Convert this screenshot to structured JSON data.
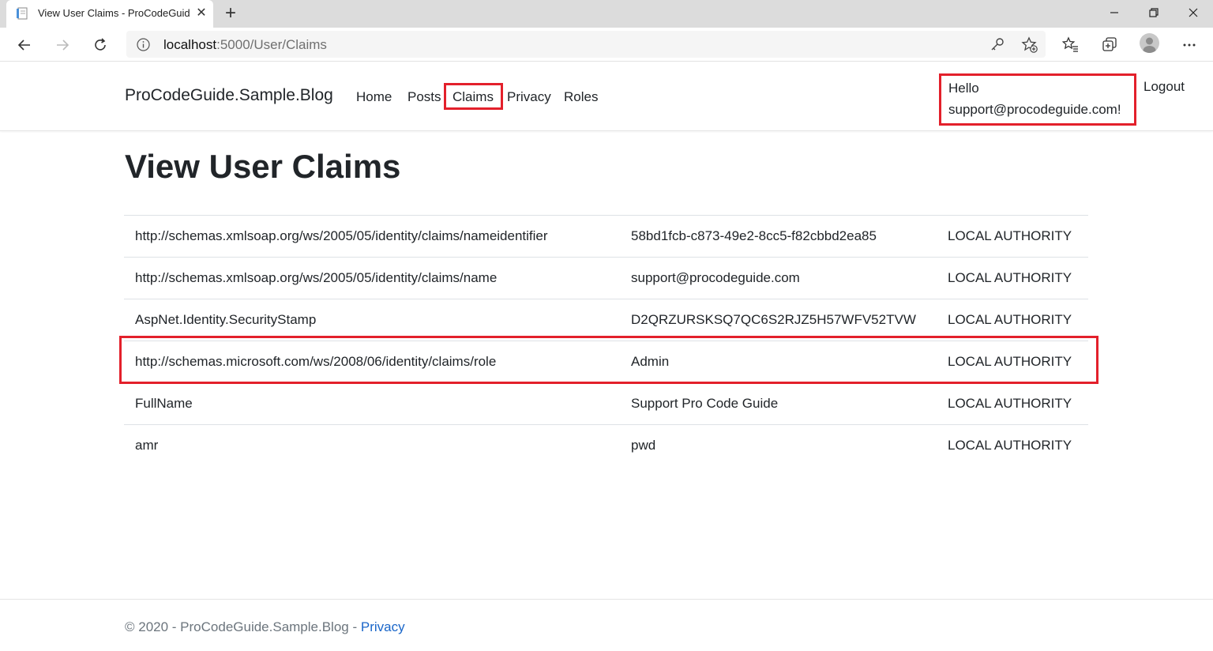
{
  "browser": {
    "tab_title": "View User Claims - ProCodeGuide",
    "url_host": "localhost",
    "url_path": ":5000/User/Claims"
  },
  "navbar": {
    "brand": "ProCodeGuide.Sample.Blog",
    "links": [
      "Home",
      "Posts",
      "Claims",
      "Privacy",
      "Roles"
    ],
    "hello_line1": "Hello",
    "hello_line2": "support@procodeguide.com!",
    "logout": "Logout"
  },
  "main": {
    "title": "View User Claims",
    "claims": [
      {
        "type": "http://schemas.xmlsoap.org/ws/2005/05/identity/claims/nameidentifier",
        "value": "58bd1fcb-c873-49e2-8cc5-f82cbbd2ea85",
        "issuer": "LOCAL AUTHORITY"
      },
      {
        "type": "http://schemas.xmlsoap.org/ws/2005/05/identity/claims/name",
        "value": "support@procodeguide.com",
        "issuer": "LOCAL AUTHORITY"
      },
      {
        "type": "AspNet.Identity.SecurityStamp",
        "value": "D2QRZURSKSQ7QC6S2RJZ5H57WFV52TVW",
        "issuer": "LOCAL AUTHORITY"
      },
      {
        "type": "http://schemas.microsoft.com/ws/2008/06/identity/claims/role",
        "value": "Admin",
        "issuer": "LOCAL AUTHORITY"
      },
      {
        "type": "FullName",
        "value": "Support Pro Code Guide",
        "issuer": "LOCAL AUTHORITY"
      },
      {
        "type": "amr",
        "value": "pwd",
        "issuer": "LOCAL AUTHORITY"
      }
    ]
  },
  "footer": {
    "copyright": "© 2020 - ProCodeGuide.Sample.Blog - ",
    "privacy_link": "Privacy"
  },
  "colors": {
    "highlight": "#e3202b",
    "link": "#1a66c9",
    "muted": "#6c757d",
    "text": "#212529"
  }
}
